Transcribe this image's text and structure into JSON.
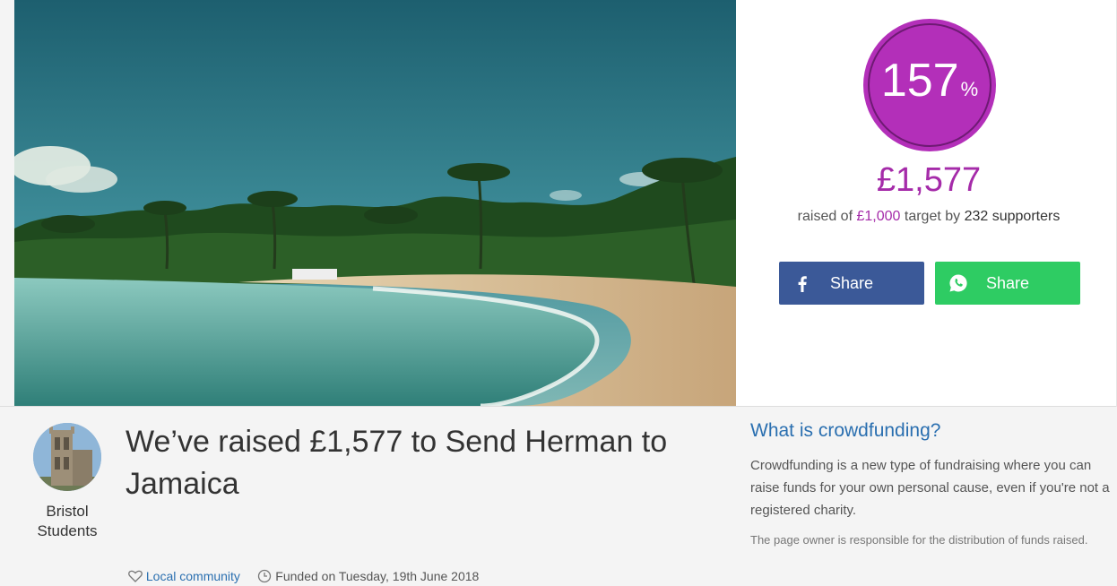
{
  "campaign": {
    "percent": "157",
    "percent_sign": "%",
    "progress_fraction": 1.57,
    "raised_amount": "£1,577",
    "raised_prefix": "raised of",
    "target_amount": "£1,000",
    "target_mid": "target by",
    "supporters": "232 supporters",
    "title": "We’ve raised £1,577 to Send Herman to Jamaica"
  },
  "share": {
    "facebook_label": "Share",
    "whatsapp_label": "Share"
  },
  "owner": {
    "name": "Bristol Students"
  },
  "meta": {
    "category": "Local community",
    "funded": "Funded on Tuesday, 19th June 2018"
  },
  "info": {
    "heading": "What is crowdfunding?",
    "body": "Crowdfunding is a new type of fundraising where you can raise funds for your own personal cause, even if you're not a registered charity.",
    "note": "The page owner is responsible for the distribution of funds raised."
  },
  "icons": {
    "facebook": "facebook-icon",
    "whatsapp": "whatsapp-icon",
    "heart": "heart-icon",
    "clock": "clock-icon"
  },
  "colors": {
    "accent_purple": "#b32fb9",
    "facebook": "#3b5998",
    "whatsapp": "#2ecc63",
    "link_blue": "#2a6fb0"
  }
}
